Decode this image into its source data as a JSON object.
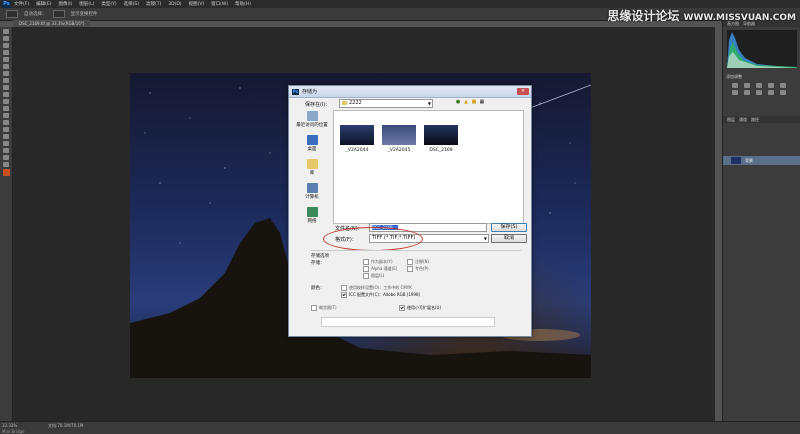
{
  "app": {
    "logo": "Ps"
  },
  "menu": [
    "文件(F)",
    "编辑(E)",
    "图像(I)",
    "图层(L)",
    "类型(Y)",
    "选择(S)",
    "滤镜(T)",
    "3D(D)",
    "视图(V)",
    "窗口(W)",
    "帮助(H)"
  ],
  "options_bar": {
    "auto_select": "自动选择：",
    "show_transform": "显示变换控件"
  },
  "document_tab": "DSC_2169.tif @ 33.3%(RGB/16*)",
  "status": {
    "zoom": "33.33%",
    "doc": "文档:70.1M/70.1M",
    "bridge": "Mini Bridge"
  },
  "panels": {
    "tabs": [
      "直方图",
      "导航器"
    ],
    "adjust_title": "添加调整",
    "layer_tabs": [
      "图层",
      "通道",
      "路径"
    ],
    "layer_name": "背景"
  },
  "watermark": {
    "line1": "思缘设计论坛",
    "line2": "WWW.MISSVUAN.COM"
  },
  "dialog": {
    "title": "存储为",
    "close": "×",
    "save_in_label": "保存在(I)：",
    "save_in_value": "2222",
    "places": [
      {
        "label": "最近访问的位置",
        "color": "#8aa6c8"
      },
      {
        "label": "桌面",
        "color": "#3a6fc0"
      },
      {
        "label": "库",
        "color": "#e7c86a"
      },
      {
        "label": "计算机",
        "color": "#5a7fb0"
      },
      {
        "label": "网络",
        "color": "#3a8a5a"
      }
    ],
    "files": [
      {
        "name": "_V2A2044",
        "colors": [
          "#2b3f6e",
          "#0e1328"
        ]
      },
      {
        "name": "_V2A2045",
        "colors": [
          "#3a4a7a",
          "#6e7aa8"
        ]
      },
      {
        "name": "DSC_2169",
        "colors": [
          "#22355f",
          "#0b0c14"
        ]
      }
    ],
    "filename_label": "文件名(N)：",
    "filename_value": "DSC_2169",
    "format_label": "格式(F)：",
    "format_value": "TIFF (*.TIF;*.TIFF)",
    "save_button": "保存(S)",
    "cancel_button": "取消",
    "options_title": "存储选项",
    "store_label": "存储：",
    "store_options": [
      {
        "label": "作为副本(Y)",
        "checked": false
      },
      {
        "label": "注释(N)",
        "checked": false
      },
      {
        "label": "Alpha 通道(E)",
        "checked": false
      },
      {
        "label": "专色(P)",
        "checked": false
      },
      {
        "label": "图层(L)",
        "checked": false
      }
    ],
    "color_label": "颜色：",
    "color_options": [
      {
        "label": "使用校样设置(O)：工作中的 CMYK",
        "checked": false
      },
      {
        "label": "ICC 配置文件(C)：Adobe RGB (1998)",
        "checked": true
      }
    ],
    "thumbnail": {
      "label": "缩览图(T)",
      "checked": false
    },
    "lowercase": {
      "label": "使用小写扩展名(U)",
      "checked": true
    }
  }
}
